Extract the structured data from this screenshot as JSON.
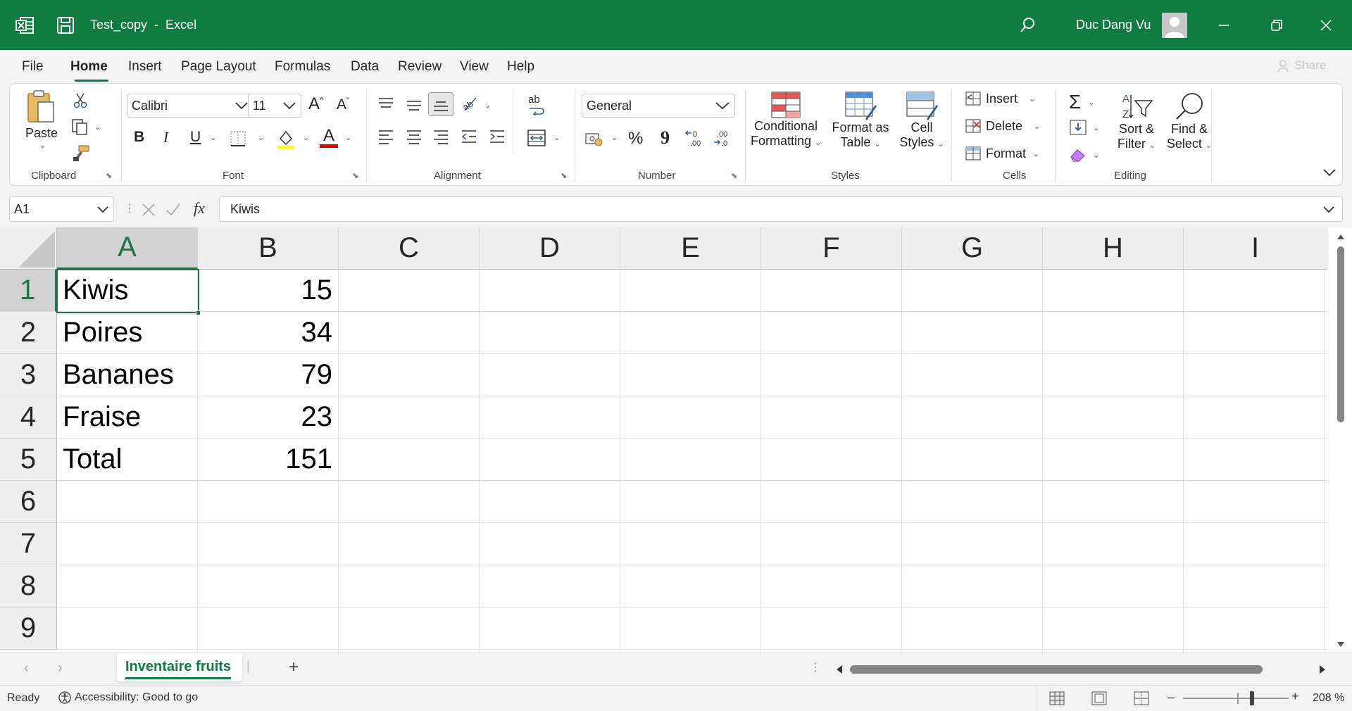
{
  "titlebar": {
    "doc_name": "Test_copy",
    "separator": "-",
    "app_name": "Excel",
    "user_name": "Duc Dang Vu",
    "color": "#107c41"
  },
  "menu": {
    "tabs": [
      "File",
      "Home",
      "Insert",
      "Page Layout",
      "Formulas",
      "Data",
      "Review",
      "View",
      "Help"
    ],
    "active": "Home",
    "share": "Share"
  },
  "ribbon": {
    "clipboard": {
      "paste": "Paste",
      "label": "Clipboard"
    },
    "font": {
      "name": "Calibri",
      "size": "11",
      "label": "Font",
      "bold": "B",
      "italic": "I",
      "underline": "U",
      "grow": "A",
      "shrink": "A",
      "font_color": "A"
    },
    "alignment": {
      "label": "Alignment",
      "wrap": "ab"
    },
    "number": {
      "format": "General",
      "label": "Number",
      "percent": "%",
      "comma": "9"
    },
    "styles": {
      "conditional_1": "Conditional",
      "conditional_2": "Formatting",
      "table_1": "Format as",
      "table_2": "Table",
      "cell_1": "Cell",
      "cell_2": "Styles",
      "label": "Styles"
    },
    "cells": {
      "insert": "Insert",
      "delete": "Delete",
      "format": "Format",
      "label": "Cells"
    },
    "editing": {
      "sort_1": "Sort &",
      "sort_2": "Filter",
      "find_1": "Find &",
      "find_2": "Select",
      "label": "Editing"
    }
  },
  "formula_bar": {
    "name_box": "A1",
    "fx": "fx",
    "content": "Kiwis"
  },
  "grid": {
    "columns": [
      "A",
      "B",
      "C",
      "D",
      "E",
      "F",
      "G",
      "H",
      "I"
    ],
    "rows": [
      "1",
      "2",
      "3",
      "4",
      "5",
      "6",
      "7",
      "8",
      "9"
    ],
    "cells": [
      [
        "Kiwis",
        "15"
      ],
      [
        "Poires",
        "34"
      ],
      [
        "Bananes",
        "79"
      ],
      [
        "Fraise",
        "23"
      ],
      [
        "Total",
        "151"
      ]
    ],
    "selected": "A1"
  },
  "sheets": {
    "tabs": [
      "Inventaire fruits"
    ],
    "add": "+"
  },
  "status": {
    "ready": "Ready",
    "accessibility": "Accessibility: Good to go",
    "zoom": "208 %",
    "zoom_minus": "–",
    "zoom_plus": "+"
  }
}
